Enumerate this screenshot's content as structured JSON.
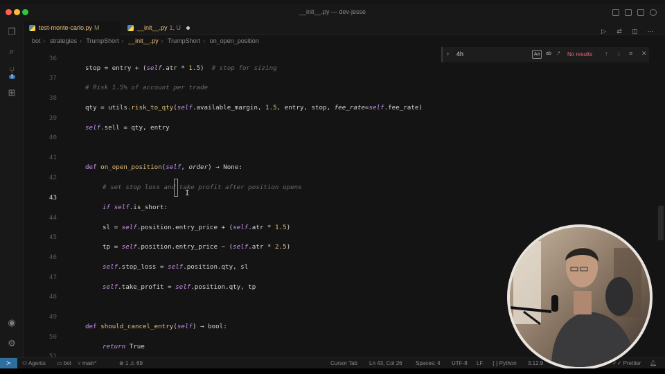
{
  "window": {
    "title": "__init__.py — dev-jesse"
  },
  "tabs": [
    {
      "label": "test-monte-carlo.py",
      "status": "M"
    },
    {
      "label": "__init__.py",
      "status": "1, U"
    }
  ],
  "breadcrumb": [
    "bot",
    "strategies",
    "TrumpShort",
    "__init__.py",
    "TrumpShort",
    "on_open_position"
  ],
  "find": {
    "value": "4h",
    "match_case_label": "Aa",
    "result": "No results"
  },
  "code": {
    "line_numbers": [
      "36",
      "37",
      "38",
      "39",
      "40",
      "41",
      "42",
      "43",
      "44",
      "45",
      "46",
      "47",
      "48",
      "49",
      "50",
      "51"
    ],
    "current_line": "43"
  },
  "statusbar": {
    "agents": "Agents",
    "bot": "bot",
    "branch": "main*",
    "problems": "⊗ 1 ⚠ 69",
    "cursor_tab": "Cursor Tab",
    "position": "Ln 43, Col 26",
    "spaces": "Spaces: 4",
    "encoding": "UTF-8",
    "eol": "LF",
    "language": "Python",
    "version": "3.12.9",
    "prettier": "Prettier"
  },
  "colors": {
    "accent": "#2d6f9e",
    "keyword": "#c792ea",
    "function": "#e6c07b",
    "comment": "#6b6b6b",
    "no_results": "#e06c75"
  }
}
